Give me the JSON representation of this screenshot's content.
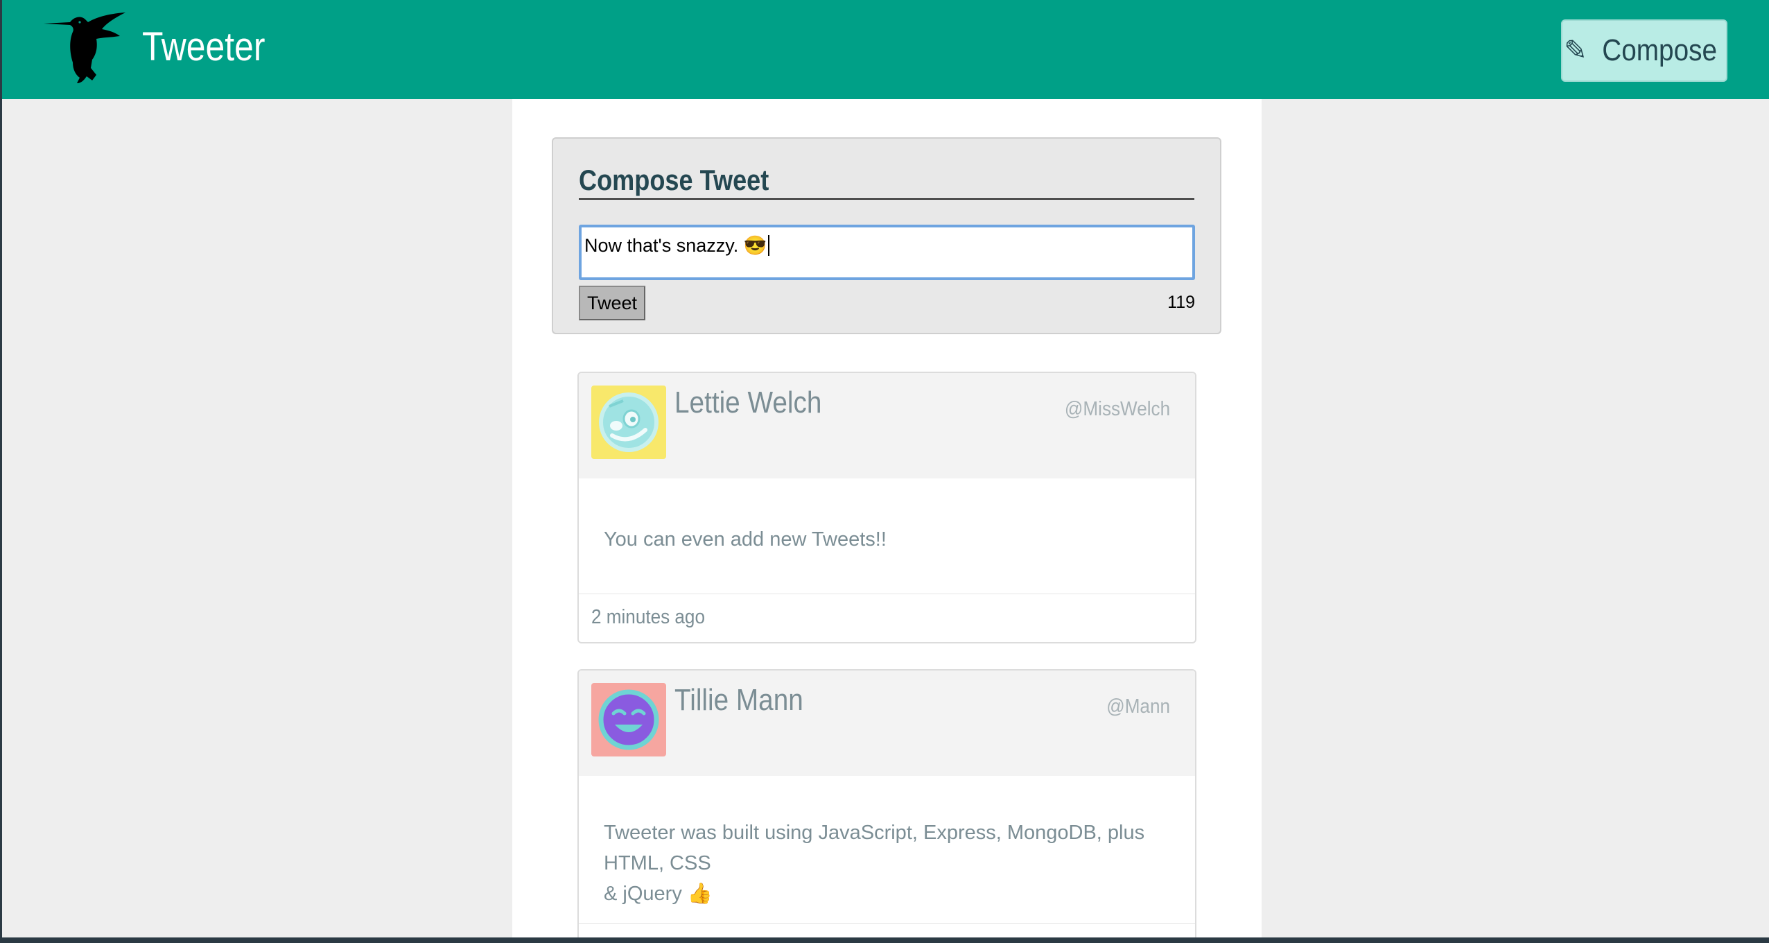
{
  "app": {
    "brand": "Tweeter",
    "compose_button": "Compose",
    "compose_icon": "pencil-icon",
    "logo_icon": "hummingbird-logo",
    "accent_color": "#00a087"
  },
  "compose": {
    "title": "Compose Tweet",
    "input_value": "Now that's snazzy. 😎",
    "tweet_button": "Tweet",
    "char_counter": "119"
  },
  "tweets": [
    {
      "name": "Lettie Welch",
      "handle": "@MissWelch",
      "body": "You can even add new Tweets!!",
      "time": "2 minutes ago",
      "avatar_color": "#f8e86b"
    },
    {
      "name": "Tillie Mann",
      "handle": "@Mann",
      "body_line1": "Tweeter was built using JavaScript, Express, MongoDB, plus HTML, CSS",
      "body_line2": "& jQuery 👍",
      "avatar_color": "#f6a6a0"
    }
  ]
}
